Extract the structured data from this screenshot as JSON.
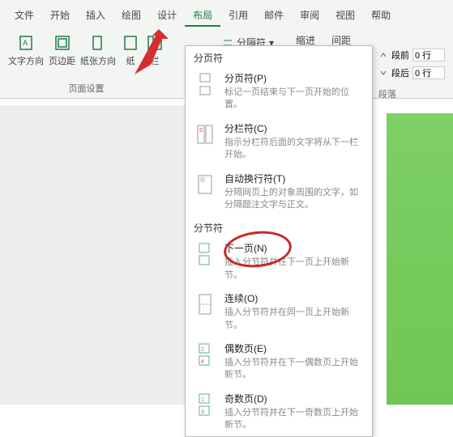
{
  "menu": {
    "items": [
      "文件",
      "开始",
      "插入",
      "绘图",
      "设计",
      "布局",
      "引用",
      "邮件",
      "审阅",
      "视图",
      "帮助"
    ],
    "active_index": 5
  },
  "ribbon": {
    "text_direction": "文字方向",
    "margins": "页边距",
    "orientation": "纸张方向",
    "size": "纸",
    "columns": "栏",
    "breaks": "分隔符",
    "indent": "缩进",
    "spacing": "间距",
    "before_label": "段前",
    "after_label": "段后",
    "before_val": "0 行",
    "after_val": "0 行",
    "group_page": "页面设置",
    "group_para": "段落"
  },
  "dropdown": {
    "sec1": "分页符",
    "i1": {
      "t": "分页符(P)",
      "d": "标记一页结束与下一页开始的位置。"
    },
    "i2": {
      "t": "分栏符(C)",
      "d": "指示分栏符后面的文字将从下一栏开始。"
    },
    "i3": {
      "t": "自动换行符(T)",
      "d": "分隔网页上的对象周围的文字，如分隔题注文字与正文。"
    },
    "sec2": "分节符",
    "i4": {
      "t": "下一页(N)",
      "d": "插入分节符并在下一页上开始新节。"
    },
    "i5": {
      "t": "连续(O)",
      "d": "插入分节符并在同一页上开始新节。"
    },
    "i6": {
      "t": "偶数页(E)",
      "d": "插入分节符并在下一偶数页上开始新节。"
    },
    "i7": {
      "t": "奇数页(D)",
      "d": "插入分节符并在下一奇数页上开始新节。"
    }
  }
}
